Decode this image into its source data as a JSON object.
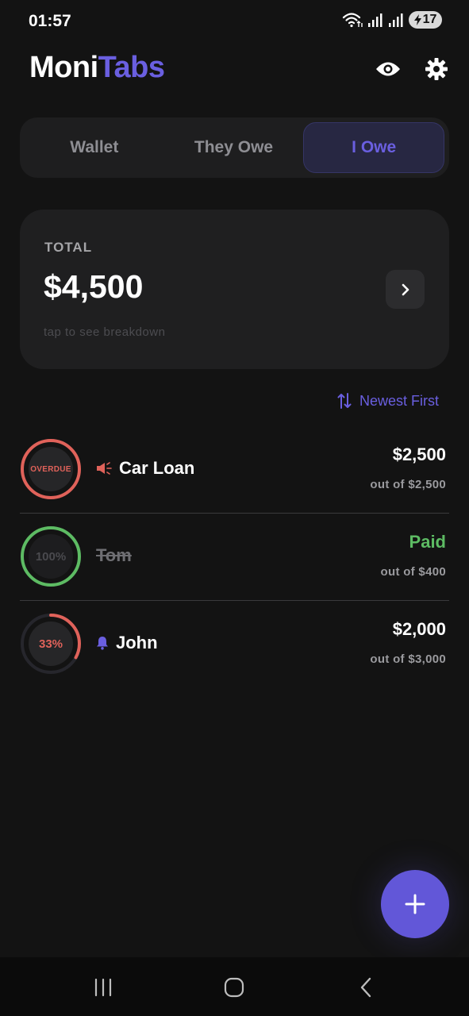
{
  "status_bar": {
    "time": "01:57",
    "battery": "17"
  },
  "header": {
    "title_part1": "Moni",
    "title_part2": "Tabs",
    "visibility_icon": "eye-icon",
    "settings_icon": "gear-icon"
  },
  "tabs": [
    {
      "label": "Wallet",
      "active": false
    },
    {
      "label": "They Owe",
      "active": false
    },
    {
      "label": "I Owe",
      "active": true
    }
  ],
  "total": {
    "label": "TOTAL",
    "amount": "$4,500",
    "hint": "tap to see breakdown"
  },
  "sort": {
    "label": "Newest First",
    "icon": "sort-arrows-icon"
  },
  "debts": [
    {
      "name": "Car Loan",
      "badge": "OVERDUE",
      "badge_icon": "megaphone-icon",
      "amount": "$2,500",
      "sub": "out of $2,500",
      "progress": 1.0,
      "status": "overdue"
    },
    {
      "name": "Tom",
      "badge": "100%",
      "amount": "Paid",
      "sub": "out of $400",
      "progress": 1.0,
      "status": "paid"
    },
    {
      "name": "John",
      "badge": "33%",
      "badge_icon": "bell-icon",
      "amount": "$2,000",
      "sub": "out of $3,000",
      "progress": 0.33,
      "status": "active"
    }
  ],
  "colors": {
    "accent": "#6a5fe0",
    "overdue": "#e0625a",
    "paid": "#5dbb63",
    "background": "#131313"
  }
}
